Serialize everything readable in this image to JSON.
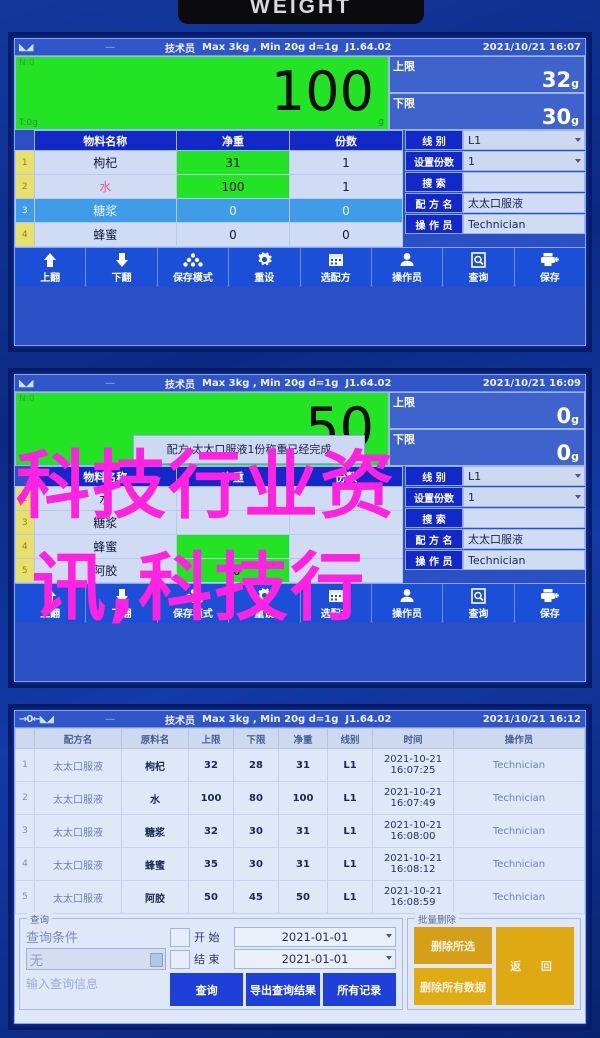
{
  "device": {
    "badge_label": "WEIGHT"
  },
  "status": {
    "user": "技术员",
    "spec": "Max 3kg , Min 20g  d=1g",
    "version": "J1.64.02",
    "indicator_zero": "→0←",
    "dash": "—"
  },
  "panels": [
    {
      "id": "panel-weighing-1",
      "time": "2021/10/21  16:07",
      "zero_indicator": "",
      "display": {
        "value": "100",
        "unit": "g",
        "net_label": "N:0",
        "tare_label": "T:0g"
      },
      "limits": [
        {
          "label": "上限",
          "value": "32",
          "unit": "g"
        },
        {
          "label": "下限",
          "value": "30",
          "unit": "g"
        }
      ],
      "table": {
        "headers": [
          "物料名称",
          "净重",
          "份数"
        ],
        "rows": [
          {
            "idx": "1",
            "name": "枸杞",
            "weight": "31",
            "portions": "1",
            "state": "green"
          },
          {
            "idx": "2",
            "name": "水",
            "weight": "100",
            "portions": "1",
            "state": "green"
          },
          {
            "idx": "3",
            "name": "糖浆",
            "weight": "0",
            "portions": "0",
            "state": "selected"
          },
          {
            "idx": "4",
            "name": "蜂蜜",
            "weight": "0",
            "portions": "0",
            "state": "normal"
          }
        ]
      },
      "fields": [
        {
          "label": "线  别",
          "value": "L1",
          "dropdown": true
        },
        {
          "label": "设置份数",
          "value": "1",
          "dropdown": true
        },
        {
          "label": "搜  索",
          "value": "",
          "dropdown": false
        },
        {
          "label": "配 方 名",
          "value": "太太口服液",
          "dropdown": false
        },
        {
          "label": "操 作 员",
          "value": "Technician",
          "dropdown": false
        }
      ]
    },
    {
      "id": "panel-weighing-2",
      "time": "2021/10/21  16:09",
      "display": {
        "value": "50",
        "unit": "g",
        "net_label": "N:0",
        "tare_label": "T:0g"
      },
      "limits": [
        {
          "label": "上限",
          "value": "0",
          "unit": "g"
        },
        {
          "label": "下限",
          "value": "0",
          "unit": "g"
        }
      ],
      "dialog": {
        "text": "配方:太太口服液1份称重已经完成"
      },
      "table": {
        "headers": [
          "物料名称",
          "净重",
          "份数"
        ],
        "rows": [
          {
            "idx": "2",
            "name": "水",
            "weight": "",
            "portions": "",
            "state": "normal"
          },
          {
            "idx": "3",
            "name": "糖浆",
            "weight": "",
            "portions": "",
            "state": "normal"
          },
          {
            "idx": "4",
            "name": "蜂蜜",
            "weight": "",
            "portions": "",
            "state": "green"
          },
          {
            "idx": "5",
            "name": "阿胶",
            "weight": "50",
            "portions": "",
            "state": "green"
          }
        ]
      },
      "fields": [
        {
          "label": "线  别",
          "value": "L1",
          "dropdown": true
        },
        {
          "label": "设置份数",
          "value": "1",
          "dropdown": true
        },
        {
          "label": "搜  索",
          "value": "",
          "dropdown": false
        },
        {
          "label": "配 方 名",
          "value": "太太口服液",
          "dropdown": false
        },
        {
          "label": "操 作 员",
          "value": "Technician",
          "dropdown": false
        }
      ]
    }
  ],
  "toolbar": [
    {
      "label": "上翻",
      "icon": "arrow-up-icon"
    },
    {
      "label": "下翻",
      "icon": "arrow-down-icon"
    },
    {
      "label": "保存模式",
      "icon": "stack-icon"
    },
    {
      "label": "重设",
      "icon": "gear-icon"
    },
    {
      "label": "选配方",
      "icon": "calendar-icon"
    },
    {
      "label": "操作员",
      "icon": "user-icon"
    },
    {
      "label": "查询",
      "icon": "document-search-icon"
    },
    {
      "label": "保存",
      "icon": "printer-plus-icon"
    }
  ],
  "records_panel": {
    "id": "panel-records",
    "time": "2021/10/21  16:12",
    "headers": [
      "配方名",
      "原料名",
      "上限",
      "下限",
      "净重",
      "线别",
      "时间",
      "操作员"
    ],
    "rows": [
      {
        "idx": "1",
        "recipe": "太太口服液",
        "material": "枸杞",
        "upper": "32",
        "lower": "28",
        "net": "31",
        "line": "L1",
        "date": "2021-10-21",
        "time": "16:07:25",
        "operator": "Technician"
      },
      {
        "idx": "2",
        "recipe": "太太口服液",
        "material": "水",
        "upper": "100",
        "lower": "80",
        "net": "100",
        "line": "L1",
        "date": "2021-10-21",
        "time": "16:07:49",
        "operator": "Technician"
      },
      {
        "idx": "3",
        "recipe": "太太口服液",
        "material": "糖浆",
        "upper": "32",
        "lower": "30",
        "net": "31",
        "line": "L1",
        "date": "2021-10-21",
        "time": "16:08:00",
        "operator": "Technician"
      },
      {
        "idx": "4",
        "recipe": "太太口服液",
        "material": "蜂蜜",
        "upper": "35",
        "lower": "30",
        "net": "31",
        "line": "L1",
        "date": "2021-10-21",
        "time": "16:08:12",
        "operator": "Technician"
      },
      {
        "idx": "5",
        "recipe": "太太口服液",
        "material": "阿胶",
        "upper": "50",
        "lower": "45",
        "net": "50",
        "line": "L1",
        "date": "2021-10-21",
        "time": "16:08:59",
        "operator": "Technician"
      }
    ],
    "query": {
      "group_label": "查询",
      "condition_label": "查询条件",
      "condition_value": "无",
      "input_placeholder": "输入查询信息",
      "start_label": "开  始",
      "start_value": "2021-01-01",
      "end_label": "结  束",
      "end_value": "2021-01-01",
      "buttons": [
        "查询",
        "导出查询结果",
        "所有记录"
      ]
    },
    "batch_delete": {
      "group_label": "批量删除",
      "delete_selected": "删除所选",
      "delete_all": "删除所有数据",
      "back": "返 回"
    }
  },
  "watermark": {
    "line1": "科技行业资",
    "line2": "讯,科技行"
  },
  "colors": {
    "screen_blue": "#2b4fc4",
    "accent_blue": "#1328c8",
    "green": "#22e324",
    "yellow": "#d5a017",
    "watermark_pink": "#ff22e0"
  }
}
